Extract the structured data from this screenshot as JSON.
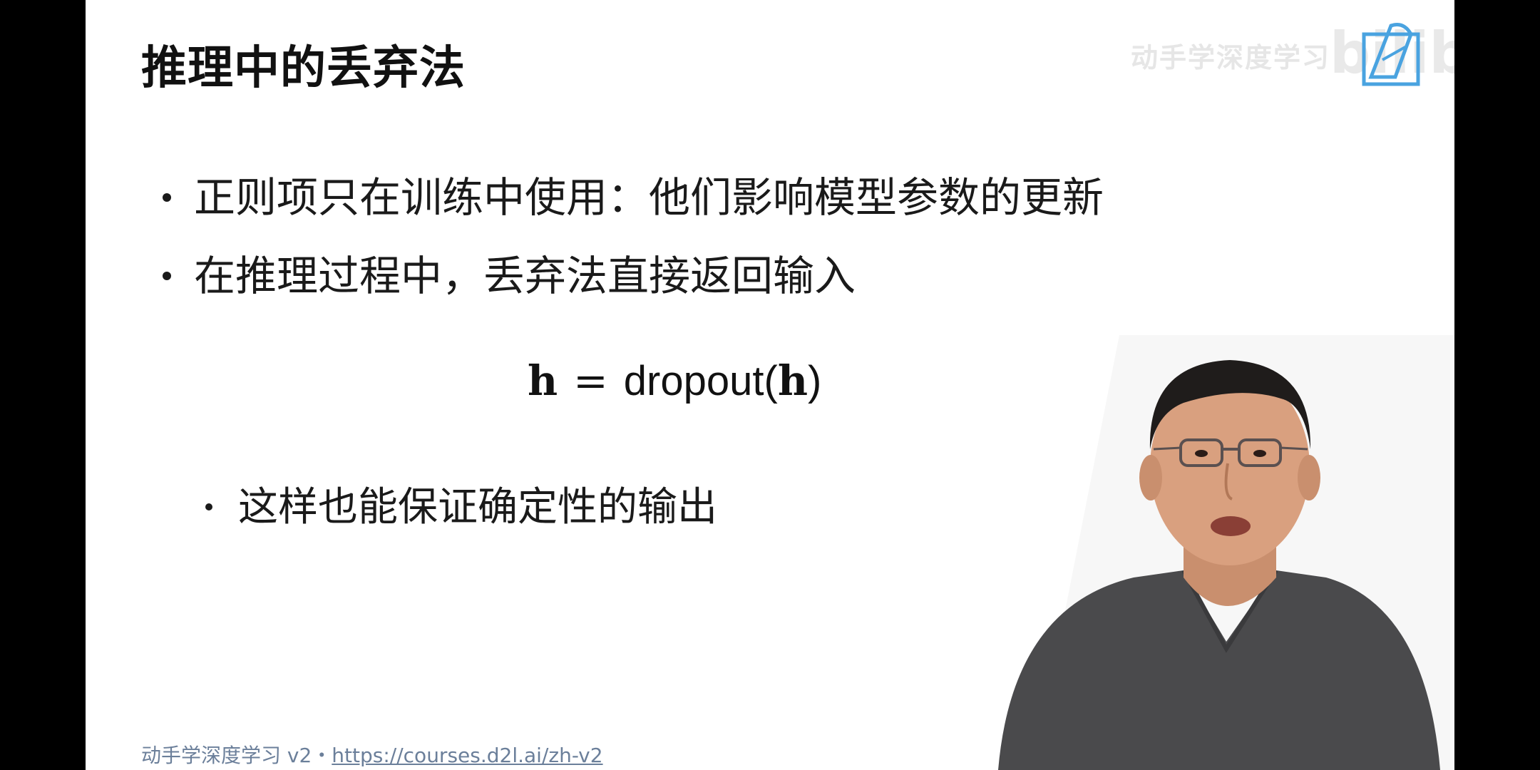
{
  "slide": {
    "title": "推理中的丢弃法",
    "watermark_text": "动手学深度学习",
    "watermark_logo": "bilibili",
    "bullets": [
      "正则项只在训练中使用：他们影响模型参数的更新",
      "在推理过程中，丢弃法直接返回输入"
    ],
    "formula": {
      "lhs": "h",
      "op": "=",
      "fn": "dropout(",
      "arg": "h",
      "close": ")"
    },
    "sub_bullet": "这样也能保证确定性的输出",
    "footer": {
      "course": "动手学深度学习 v2・",
      "url": "https://courses.d2l.ai/zh-v2"
    }
  },
  "colors": {
    "background": "#000000",
    "slide": "#ffffff",
    "text": "#1a1a1a",
    "footer": "#6b7f9a",
    "logo_blue": "#4aa3e0"
  }
}
